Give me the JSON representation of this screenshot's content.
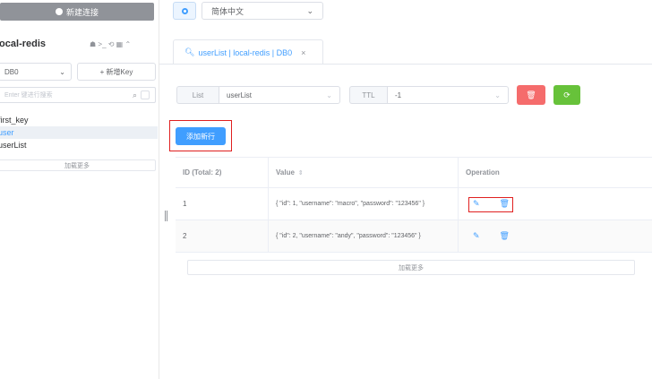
{
  "sidebar": {
    "new_connection_label": "新建连接",
    "connection_name": "local-redis",
    "tools_label": "☗ >_ ⟲ ▦ ⌃",
    "db_select": {
      "value": "DB0",
      "chevron": "⌄"
    },
    "new_key_label": "+ 新增Key",
    "search_placeholder": "Enter 键进行搜索",
    "search_icon": "⌕",
    "keys": [
      "first_key",
      "user",
      "userList"
    ],
    "active_key": "user",
    "load_more_label": "加载更多"
  },
  "topbar": {
    "language_value": "简体中文",
    "chevron": "⌄"
  },
  "tab": {
    "icon": "🔍︎",
    "label": "userList | local-redis | DB0",
    "close": "×"
  },
  "key_detail": {
    "type_label": "List",
    "key_name": "userList",
    "ttl_label": "TTL",
    "ttl_value": "-1",
    "chevron": "⌄",
    "delete_icon": "🗑",
    "refresh_icon": "⟳"
  },
  "add_row_label": "添加新行",
  "table": {
    "headers": {
      "id": "ID (Total: 2)",
      "value": "Value",
      "operation": "Operation",
      "sort_icon": "⇕"
    },
    "rows": [
      {
        "id": "1",
        "value": "{ \"id\": 1, \"username\": \"macro\", \"password\": \"123456\" }",
        "edit_icon": "✎",
        "delete_icon": "🗑"
      },
      {
        "id": "2",
        "value": "{ \"id\": 2, \"username\": \"andy\", \"password\": \"123456\" }",
        "edit_icon": "✎",
        "delete_icon": "🗑"
      }
    ]
  },
  "load_more_label": "加载更多",
  "colors": {
    "primary": "#409eff",
    "danger": "#f56c6c",
    "success": "#67c23a",
    "highlight": "#e02020"
  }
}
